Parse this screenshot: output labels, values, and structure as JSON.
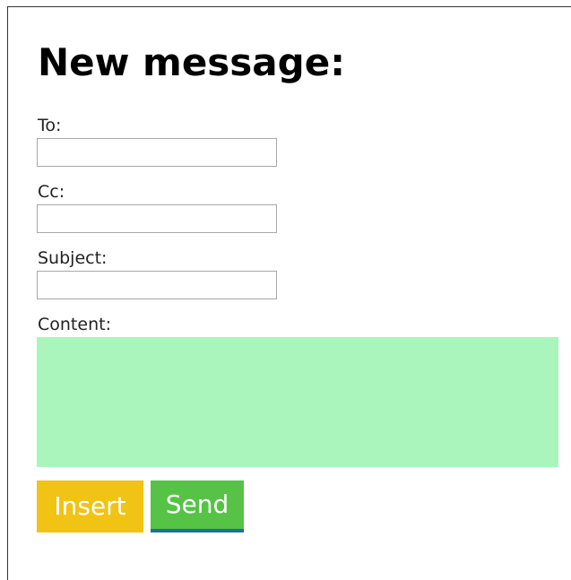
{
  "form": {
    "title": "New message:",
    "to_label": "To:",
    "to_value": "",
    "cc_label": "Cc:",
    "cc_value": "",
    "subject_label": "Subject:",
    "subject_value": "",
    "content_label": "Content:",
    "content_value": "",
    "insert_label": "Insert",
    "send_label": "Send"
  },
  "colors": {
    "content_background": "#a9f5bc",
    "insert_button": "#f0c315",
    "send_button": "#56c246",
    "send_button_underline": "#1e6e9e"
  }
}
